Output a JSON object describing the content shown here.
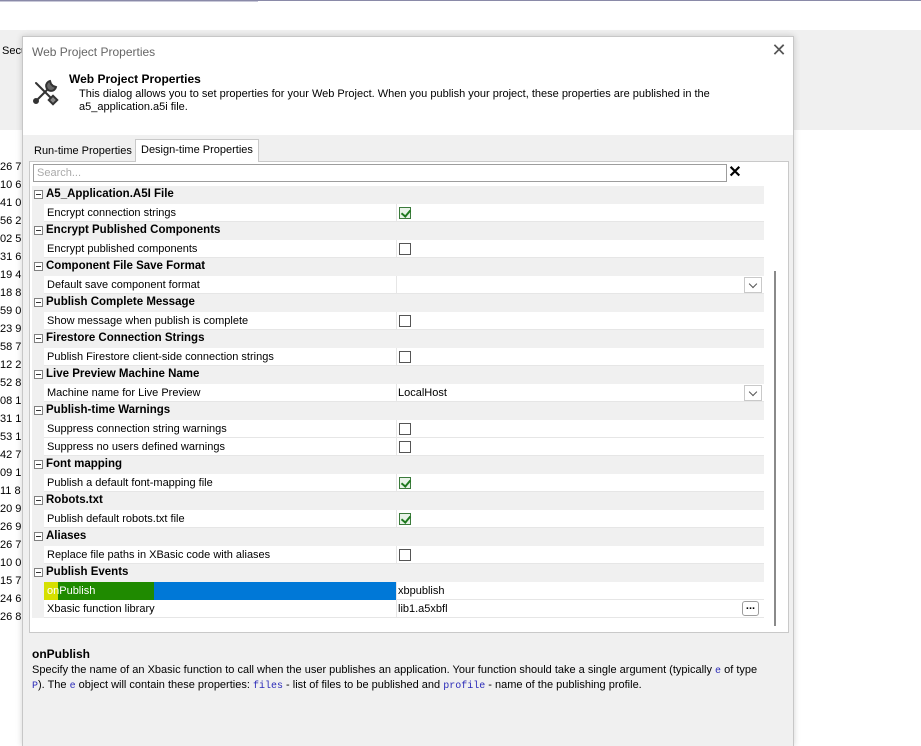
{
  "background": {
    "partial_label": "Secu",
    "left_numbers": [
      "26 7",
      "10 6",
      "41 0",
      "56 2",
      "02 5",
      "31 6",
      "19 4",
      "18 8",
      "59 0",
      "23 9",
      "58 7",
      "12 2",
      "52 8",
      "08 1",
      "31 1",
      "53 1",
      "42 7",
      "09 1",
      "11 8",
      "20 9",
      "26 9",
      "26 7",
      "10 0",
      "15 7",
      "24 6",
      "26 8"
    ]
  },
  "dialog": {
    "title": "Web Project Properties",
    "close_glyph": "✕",
    "header": {
      "title": "Web Project Properties",
      "description": "This dialog allows you to set properties for your Web Project. When you publish your project, these properties are published in the a5_application.a5i file."
    },
    "tabs": [
      {
        "label": "Run-time Properties",
        "active": false
      },
      {
        "label": "Design-time Properties",
        "active": true
      }
    ],
    "search": {
      "placeholder": "Search...",
      "value": "",
      "clear_glyph": "✕"
    },
    "rows": [
      {
        "type": "category",
        "label": "A5_Application.A5I File"
      },
      {
        "type": "property",
        "name": "Encrypt connection strings",
        "kind": "checkbox",
        "checked": true
      },
      {
        "type": "category",
        "label": "Encrypt Published Components"
      },
      {
        "type": "property",
        "name": "Encrypt published components",
        "kind": "checkbox",
        "checked": false
      },
      {
        "type": "category",
        "label": "Component File Save Format"
      },
      {
        "type": "property",
        "name": "Default save component format",
        "kind": "dropdown",
        "value": ""
      },
      {
        "type": "category",
        "label": "Publish Complete Message"
      },
      {
        "type": "property",
        "name": "Show message when publish is complete",
        "kind": "checkbox",
        "checked": false
      },
      {
        "type": "category",
        "label": "Firestore Connection Strings"
      },
      {
        "type": "property",
        "name": "Publish Firestore client-side connection strings",
        "kind": "checkbox",
        "checked": false
      },
      {
        "type": "category",
        "label": "Live Preview Machine Name"
      },
      {
        "type": "property",
        "name": "Machine name for Live Preview",
        "kind": "dropdown",
        "value": "LocalHost"
      },
      {
        "type": "category",
        "label": "Publish-time Warnings"
      },
      {
        "type": "property",
        "name": "Suppress connection string warnings",
        "kind": "checkbox",
        "checked": false
      },
      {
        "type": "property",
        "name": "Suppress no users defined warnings",
        "kind": "checkbox",
        "checked": false
      },
      {
        "type": "category",
        "label": "Font mapping"
      },
      {
        "type": "property",
        "name": "Publish a default font-mapping file",
        "kind": "checkbox",
        "checked": true
      },
      {
        "type": "category",
        "label": "Robots.txt"
      },
      {
        "type": "property",
        "name": "Publish default robots.txt file",
        "kind": "checkbox",
        "checked": true
      },
      {
        "type": "category",
        "label": "Aliases"
      },
      {
        "type": "property",
        "name": "Replace file paths in XBasic code with aliases",
        "kind": "checkbox",
        "checked": false
      },
      {
        "type": "category",
        "label": "Publish Events"
      },
      {
        "type": "property",
        "name": "onPublish",
        "kind": "text",
        "value": "xbpublish",
        "selected": true
      },
      {
        "type": "property",
        "name": "Xbasic function library",
        "kind": "ellipsis",
        "value": "lib1.a5xbfl",
        "button_label": "..."
      }
    ],
    "description": {
      "title": "onPublish",
      "text_1": "Specify the name of an Xbasic function to call when the user publishes an application. Your function should take a single argument (typically ",
      "code_e": "e",
      "text_2": " of type ",
      "code_p": "P",
      "text_3": "). The ",
      "code_e2": "e",
      "text_4": " object will contain these properties: ",
      "code_files": "files",
      "text_5": " - list of files to be published and ",
      "code_profile": "profile",
      "text_6": " - name of the publishing profile."
    }
  }
}
